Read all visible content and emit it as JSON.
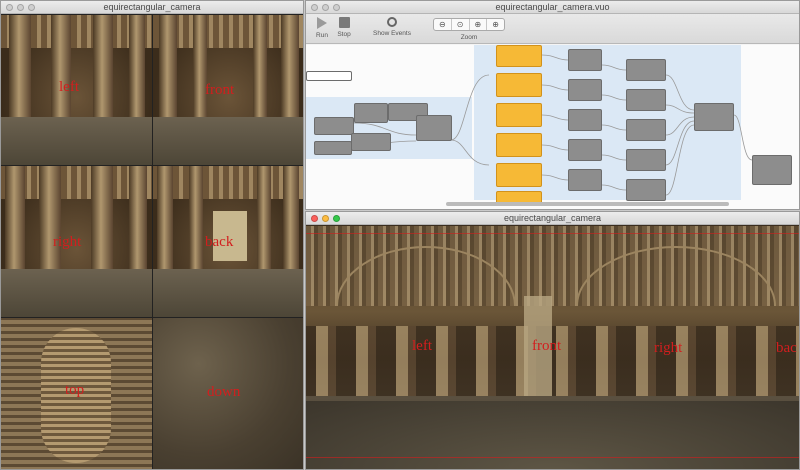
{
  "left_window": {
    "title": "equirectangular_camera",
    "faces": [
      {
        "name": "left",
        "label": "left"
      },
      {
        "name": "front",
        "label": "front"
      },
      {
        "name": "right",
        "label": "right"
      },
      {
        "name": "back",
        "label": "back"
      },
      {
        "name": "top",
        "label": "top"
      },
      {
        "name": "down",
        "label": "down"
      }
    ]
  },
  "editor_window": {
    "title": "equirectangular_camera.vuo",
    "toolbar": {
      "run": "Run",
      "stop": "Stop",
      "show_events": "Show Events",
      "zoom": "Zoom",
      "zoom_buttons": [
        "⊖",
        "⊙",
        "⊕",
        "⊕"
      ]
    }
  },
  "output_window": {
    "title": "equirectangular_camera",
    "labels": [
      "left",
      "front",
      "right",
      "bac"
    ]
  },
  "colors": {
    "label_red": "#d21e1e",
    "node_yellow": "#f6b936",
    "comment_blue": "#dbe8f5"
  }
}
